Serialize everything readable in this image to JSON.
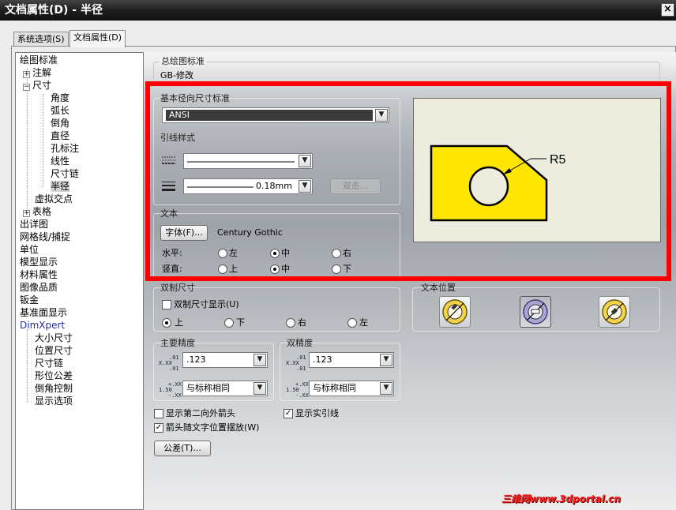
{
  "window": {
    "title": "文档属性(D) - 半径",
    "close_glyph": "×"
  },
  "tabs": [
    {
      "label": "系统选项(S)",
      "active": false
    },
    {
      "label": "文档属性(D)",
      "active": true
    }
  ],
  "tree": {
    "items": [
      {
        "label": "绘图标准",
        "expander": ""
      },
      {
        "label": "注解",
        "expander": "+"
      },
      {
        "label": "尺寸",
        "expander": "−"
      },
      {
        "label": "角度",
        "expander": ""
      },
      {
        "label": "弧长",
        "expander": ""
      },
      {
        "label": "倒角",
        "expander": ""
      },
      {
        "label": "直径",
        "expander": ""
      },
      {
        "label": "孔标注",
        "expander": ""
      },
      {
        "label": "线性",
        "expander": ""
      },
      {
        "label": "尺寸链",
        "expander": ""
      },
      {
        "label": "半径",
        "expander": "",
        "selected": true
      },
      {
        "label": "虚拟交点",
        "expander": ""
      },
      {
        "label": "表格",
        "expander": "+"
      },
      {
        "label": "出详图",
        "expander": ""
      },
      {
        "label": "网格线/捕捉",
        "expander": ""
      },
      {
        "label": "单位",
        "expander": ""
      },
      {
        "label": "模型显示",
        "expander": ""
      },
      {
        "label": "材料属性",
        "expander": ""
      },
      {
        "label": "图像品质",
        "expander": ""
      },
      {
        "label": "钣金",
        "expander": ""
      },
      {
        "label": "基准面显示",
        "expander": ""
      },
      {
        "label": "DimXpert",
        "expander": ""
      },
      {
        "label": "大小尺寸",
        "expander": ""
      },
      {
        "label": "位置尺寸",
        "expander": ""
      },
      {
        "label": "尺寸链",
        "expander": ""
      },
      {
        "label": "形位公差",
        "expander": ""
      },
      {
        "label": "倒角控制",
        "expander": ""
      },
      {
        "label": "显示选项",
        "expander": ""
      }
    ]
  },
  "overall_standard": {
    "label": "总绘图标准",
    "value": "GB-修改"
  },
  "base_standard": {
    "label": "基本径向尺寸标准",
    "value": "ANSI"
  },
  "leader_style": {
    "label": "引线样式",
    "thickness_value": "0.18mm",
    "disabled_button": "双击..."
  },
  "text": {
    "label": "文本",
    "font_button": "字体(F)...",
    "font_name": "Century Gothic",
    "horizontal_label": "水平:",
    "vertical_label": "竖直:",
    "h_options": [
      "左",
      "中",
      "右"
    ],
    "h_selected": 1,
    "v_options": [
      "上",
      "中",
      "下"
    ],
    "v_selected": 1
  },
  "preview": {
    "dimension_text": "R5",
    "fill_color": "#ffe600"
  },
  "dual": {
    "label": "双制尺寸",
    "checkbox_label": "双制尺寸显示(U)",
    "checked": false,
    "options": [
      "上",
      "下",
      "右",
      "左"
    ],
    "selected": 0
  },
  "text_position": {
    "label": "文本位置",
    "selected": 1
  },
  "primary_precision": {
    "label": "主要精度",
    "value": ".123",
    "tolerance": "与标称相同"
  },
  "dual_precision": {
    "label": "双精度",
    "value": ".123",
    "tolerance": "与标称相同"
  },
  "icons": {
    "precision_top": "X.XX",
    "precision_sup": ".01",
    "tol_main": "1.50",
    "tol_sup": "+.XX",
    "tol_sub": "-.XX"
  },
  "checks": {
    "second_arrow": {
      "label": "显示第二向外箭头",
      "checked": false
    },
    "solid_leader": {
      "label": "显示实引线",
      "checked": true
    },
    "arrow_follow": {
      "label": "箭头随文字位置摆放(W)",
      "checked": true
    }
  },
  "tolerance_button": "公差(T)...",
  "watermark": "三维网www.3dportal.cn",
  "colors": {
    "highlight_frame": "#ff0000",
    "preview_bg": "#ededdf"
  }
}
